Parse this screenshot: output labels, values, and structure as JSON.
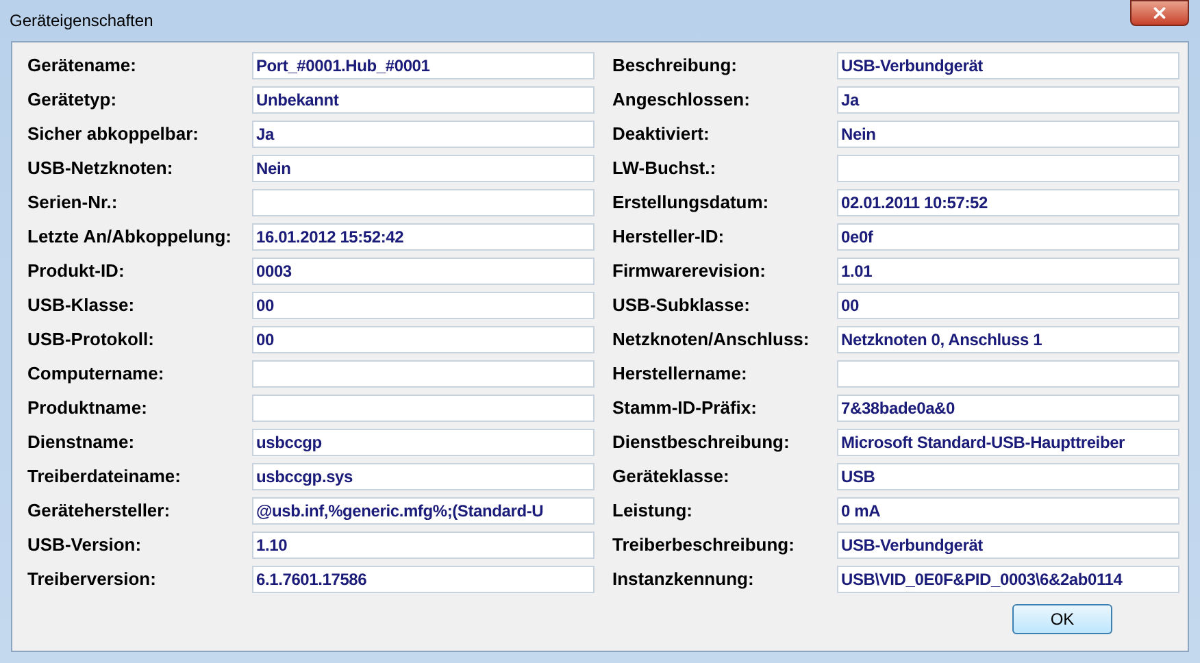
{
  "window": {
    "title": "Geräteigenschaften"
  },
  "rows": [
    {
      "left": {
        "label": "Gerätename:",
        "value": "Port_#0001.Hub_#0001"
      },
      "right": {
        "label": "Beschreibung:",
        "value": "USB-Verbundgerät"
      }
    },
    {
      "left": {
        "label": "Gerätetyp:",
        "value": "Unbekannt"
      },
      "right": {
        "label": "Angeschlossen:",
        "value": "Ja"
      }
    },
    {
      "left": {
        "label": "Sicher abkoppelbar:",
        "value": "Ja"
      },
      "right": {
        "label": "Deaktiviert:",
        "value": "Nein"
      }
    },
    {
      "left": {
        "label": "USB-Netzknoten:",
        "value": "Nein"
      },
      "right": {
        "label": "LW-Buchst.:"
      }
    },
    {
      "left": {
        "label": "Serien-Nr.:"
      },
      "right": {
        "label": "Erstellungsdatum:",
        "value": "02.01.2011 10:57:52"
      }
    },
    {
      "left": {
        "label": "Letzte An/Abkoppelung:",
        "value": "16.01.2012 15:52:42"
      },
      "right": {
        "label": "Hersteller-ID:",
        "value": "0e0f"
      }
    },
    {
      "left": {
        "label": "Produkt-ID:",
        "value": "0003"
      },
      "right": {
        "label": "Firmwarerevision:",
        "value": "1.01"
      }
    },
    {
      "left": {
        "label": "USB-Klasse:",
        "value": "00"
      },
      "right": {
        "label": "USB-Subklasse:",
        "value": "00"
      }
    },
    {
      "left": {
        "label": "USB-Protokoll:",
        "value": "00"
      },
      "right": {
        "label": "Netzknoten/Anschluss:",
        "value": "Netzknoten 0, Anschluss 1"
      }
    },
    {
      "left": {
        "label": "Computername:"
      },
      "right": {
        "label": "Herstellername:"
      }
    },
    {
      "left": {
        "label": "Produktname:"
      },
      "right": {
        "label": "Stamm-ID-Präfix:",
        "value": "7&38bade0a&0"
      }
    },
    {
      "left": {
        "label": "Dienstname:",
        "value": "usbccgp"
      },
      "right": {
        "label": "Dienstbeschreibung:",
        "value": "Microsoft Standard-USB-Haupttreiber"
      }
    },
    {
      "left": {
        "label": "Treiberdateiname:",
        "value": "usbccgp.sys"
      },
      "right": {
        "label": "Geräteklasse:",
        "value": "USB"
      }
    },
    {
      "left": {
        "label": "Gerätehersteller:",
        "value": "@usb.inf,%generic.mfg%;(Standard-U"
      },
      "right": {
        "label": "Leistung:",
        "value": "0 mA"
      }
    },
    {
      "left": {
        "label": "USB-Version:",
        "value": "1.10"
      },
      "right": {
        "label": "Treiberbeschreibung:",
        "value": "USB-Verbundgerät"
      }
    },
    {
      "left": {
        "label": "Treiberversion:",
        "value": "6.1.7601.17586"
      },
      "right": {
        "label": "Instanzkennung:",
        "value": "USB\\VID_0E0F&PID_0003\\6&2ab0114"
      }
    }
  ],
  "buttons": [
    "OK"
  ]
}
